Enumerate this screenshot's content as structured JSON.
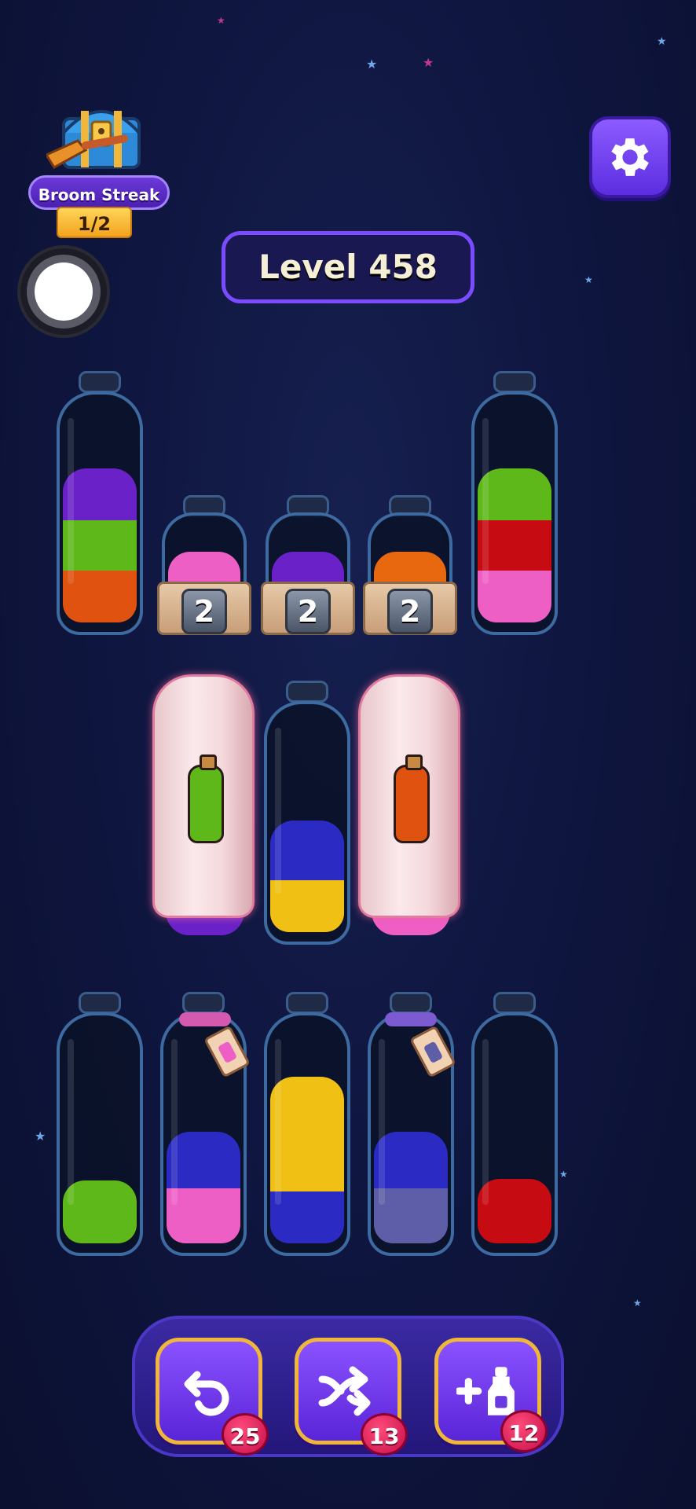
{
  "streak": {
    "title": "Broom Streak",
    "progress": "1/2"
  },
  "level": {
    "label": "Level 458"
  },
  "colors": {
    "purple": "#6a22c8",
    "green": "#5fb81a",
    "orange": "#e0520f",
    "red": "#c70b12",
    "pink": "#ee5fc6",
    "blue": "#2b2bc4",
    "yellow": "#f0c014",
    "slate": "#5e5ea8"
  },
  "locked_bottles": [
    {
      "count": "2",
      "color": "pink"
    },
    {
      "count": "2",
      "color": "purple"
    },
    {
      "count": "2",
      "color": "orange"
    }
  ],
  "covered_bottles": [
    {
      "hint_color": "green",
      "base_color": "purple"
    },
    {
      "hint_color": "orange",
      "base_color": "pink"
    }
  ],
  "bottles_row1": [
    {
      "layers": [
        "orange",
        "green",
        "purple"
      ]
    },
    {
      "layers": [
        "pink",
        "red",
        "green"
      ]
    }
  ],
  "bottle_row2_middle": {
    "layers": [
      "yellow",
      "blue"
    ]
  },
  "bottles_row3": [
    {
      "layers": [
        "green"
      ],
      "tied": false
    },
    {
      "layers": [
        "pink",
        "blue"
      ],
      "tied": true,
      "tie_color": "pink"
    },
    {
      "layers": [
        "blue",
        "yellow",
        "yellow"
      ],
      "tied": false
    },
    {
      "layers": [
        "slate",
        "blue"
      ],
      "tied": true,
      "tie_color": "slate"
    },
    {
      "layers": [
        "red"
      ],
      "tied": false
    }
  ],
  "boosters": [
    {
      "name": "undo",
      "icon": "undo-icon",
      "count": "25"
    },
    {
      "name": "shuffle",
      "icon": "shuffle-icon",
      "count": "13"
    },
    {
      "name": "add-bottle",
      "icon": "add-bottle-icon",
      "count": "12"
    }
  ]
}
